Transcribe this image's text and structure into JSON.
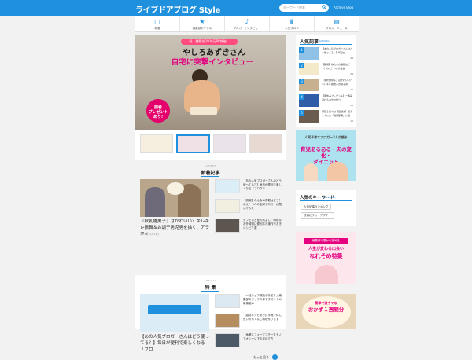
{
  "header": {
    "logo": "ライブドアブログ Style",
    "search_placeholder": "キーワード検索",
    "archive_label": "Archive Blog"
  },
  "nav": {
    "items": [
      {
        "label": "新着"
      },
      {
        "label": "編集部おすすめ"
      },
      {
        "label": "ブロガーインタビュー"
      },
      {
        "label": "人気ブログ"
      },
      {
        "label": "ブロガーニュース"
      }
    ]
  },
  "hero": {
    "subheading": "祝・書籍化2000万PV突破！",
    "title_line1": "やしろあずきさん",
    "title_line2": "自宅に突撃インタビュー",
    "badge": "読者\nプレゼント\nあり!"
  },
  "new_articles": {
    "en": "LATEST",
    "title": "新着記事",
    "featured_title": "『秋乳雛男子』はかわいい？キレキレ振舞＆お調子男児男を描く、アラフィ",
    "featured_date": "2019年10月23日",
    "items": [
      {
        "text": "【あの人気ブロガーさんはどう使ってる？】毎日が便利で楽しくなる「ブログリ",
        "date": "2019年10月23日"
      },
      {
        "text": "【朗報】みんなの書籍はどう？ねえ？ 3人の主婦ブロガーに聞いてみた",
        "date": "2019年10月23日"
      },
      {
        "text": "カフェなど室内もよし！時短＆お外時短に便利な冷凍作りおきレシピ５選",
        "date": "2019年10月22日"
      }
    ]
  },
  "feature": {
    "en": "SPECIAL",
    "title": "特 集",
    "featured_title": "【あの人気ブロガーさんはどう使ってる？】毎日が便利で楽しくなる「ブロ",
    "items": [
      {
        "text": "「一括シェア機能がある？」編集部スタッフのおすすめ！その新機能の"
      },
      {
        "text": "【雑誌レシピあり】手軽で体に良いおもてなし料理作ります"
      },
      {
        "text": "【休業にフォーアプチー】モノでオシャレ下の足の立ち"
      }
    ],
    "more_label": "もっと見る"
  },
  "ranking": {
    "title": "人気記事",
    "title_en": "RANKING",
    "items": [
      {
        "num": "1",
        "text": "【あの人気ブロガーさんはどう使ってる？】毎日が",
        "count": "48"
      },
      {
        "num": "2",
        "text": "【朗報】みんなの書籍はどう？ねえ？ 3人の主婦",
        "count": "38"
      },
      {
        "num": "3",
        "text": "『言状鍋男子』はかわいい？キレキレ振舞＆お調子男",
        "count": "29"
      },
      {
        "num": "4",
        "text": "【夏休みプレゼント】一番喜ばれるおやつ作り",
        "count": "24"
      },
      {
        "num": "5",
        "text": "頑張る日々は【自然派】鍛える人にお「健康部屋」に紹",
        "count": "16"
      }
    ]
  },
  "banner1": {
    "sub": "人気子育てブロガー3人が語る",
    "title": "育児あるある・夫の変化・\nダイエット"
  },
  "keywords": {
    "title": "人気のキーワード",
    "title_en": "KEYWORD",
    "tags": [
      "人気記事ランキング",
      "快適にフォーアプチー"
    ]
  },
  "banner2": {
    "head": "編集部の春から始める",
    "sub": "人生が変わる出会い",
    "title": "なれそめ特集"
  },
  "banner3": {
    "sub": "簡単で激ウマな",
    "title": "おかず１週間分"
  },
  "colors": {
    "brand": "#1e90dd",
    "accent": "#e4007f"
  }
}
